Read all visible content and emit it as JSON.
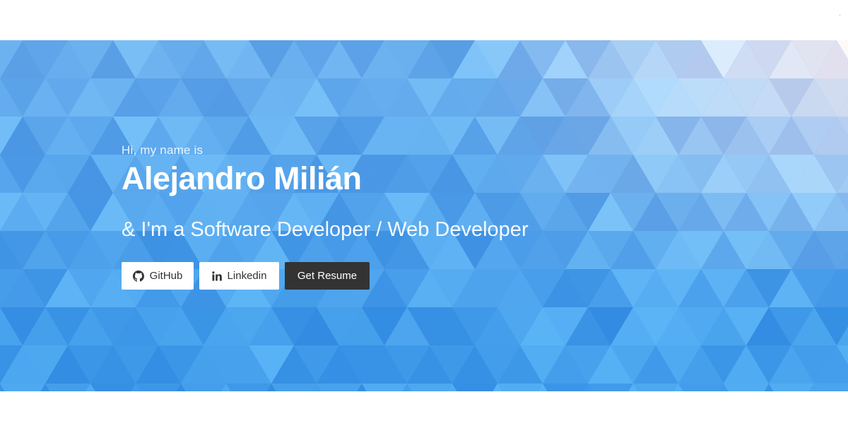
{
  "hero": {
    "greeting": "Hi, my name is",
    "name": "Alejandro Milián",
    "tagline": "& I'm a Software Developer / Web Developer",
    "buttons": {
      "github": {
        "label": "GitHub",
        "icon": "github-icon"
      },
      "linkedin": {
        "label": "Linkedin",
        "icon": "linkedin-icon"
      },
      "resume": {
        "label": "Get Resume"
      }
    }
  },
  "colors": {
    "hero_blue": "#4aa3ee",
    "button_light": "#ffffff",
    "button_dark": "#333333",
    "text_light": "#ffffff"
  }
}
